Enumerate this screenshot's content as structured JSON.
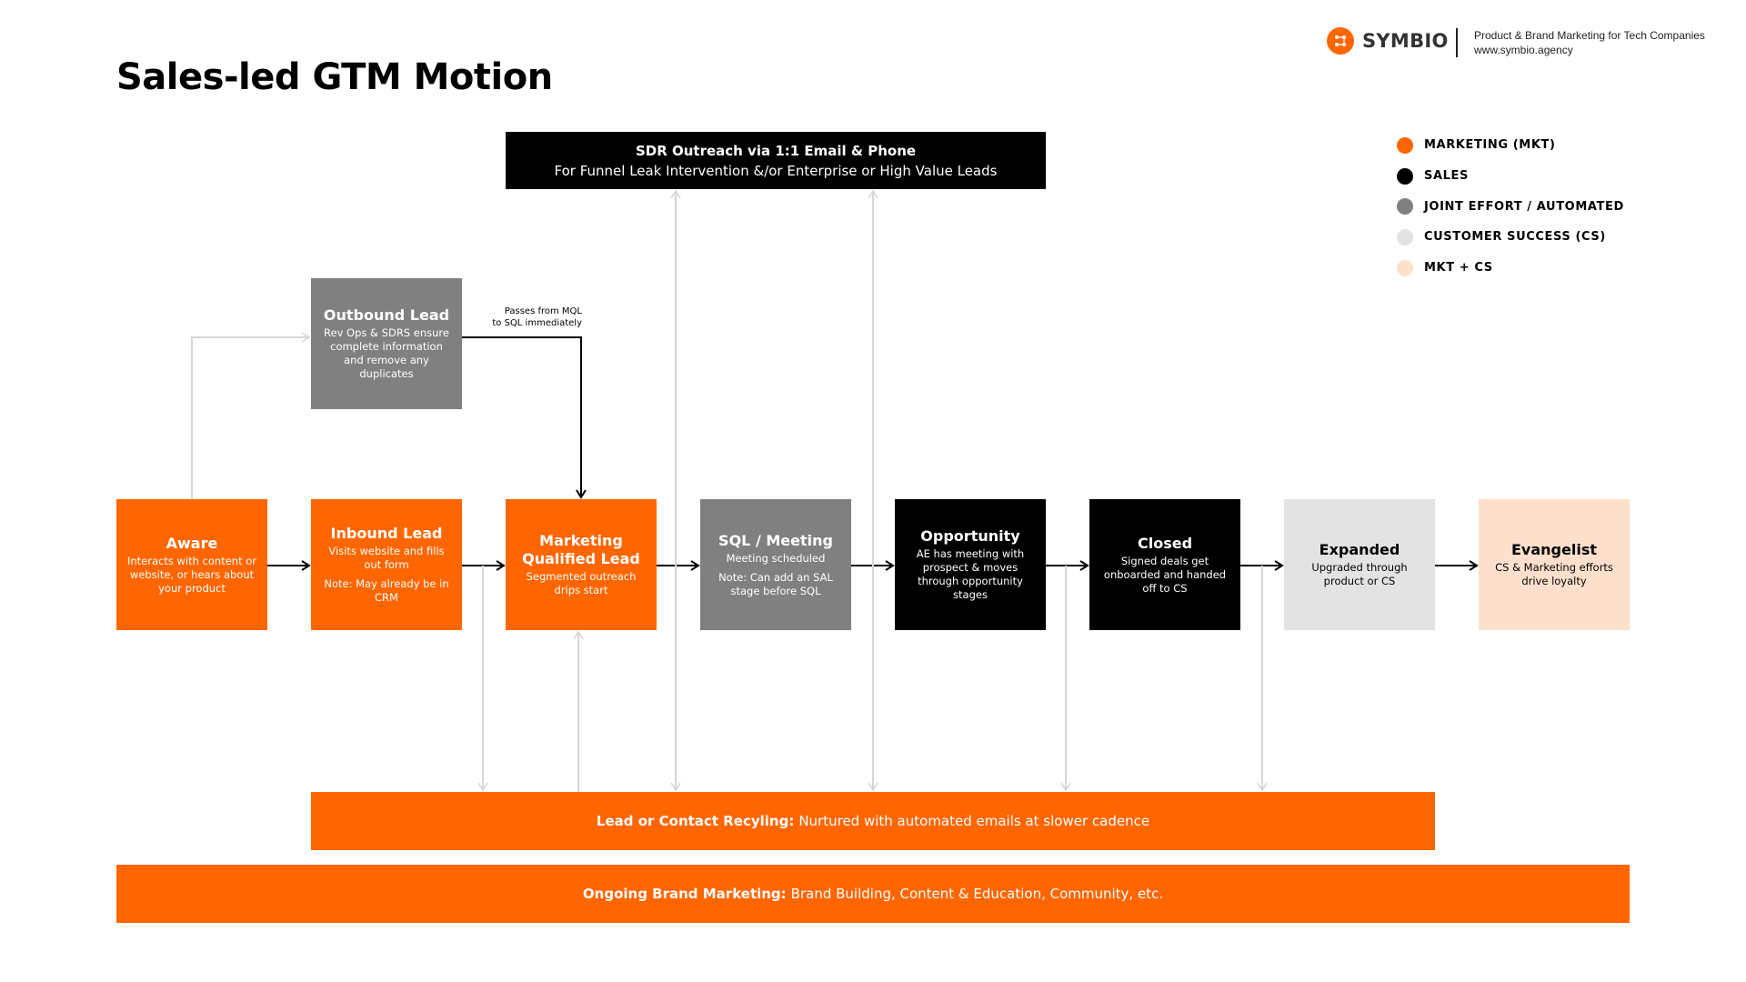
{
  "title": "Sales-led GTM Motion",
  "brand": {
    "logo_icon": "symbio-nodes-icon",
    "name": "SYMBIO",
    "tagline": "Product & Brand Marketing for Tech Companies",
    "website": "www.symbio.agency"
  },
  "colors": {
    "marketing": "#ff6600",
    "sales": "#000000",
    "joint": "#808080",
    "cs": "#e3e3e3",
    "mkt_cs": "#fde0cc",
    "connector_light": "#d6d6d6"
  },
  "legend": [
    {
      "label": "MARKETING (MKT)",
      "color": "#ff6600"
    },
    {
      "label": "SALES",
      "color": "#000000"
    },
    {
      "label": "JOINT EFFORT / AUTOMATED",
      "color": "#808080"
    },
    {
      "label": "CUSTOMER SUCCESS (CS)",
      "color": "#e3e3e3"
    },
    {
      "label": "MKT + CS",
      "color": "#fde0cc"
    }
  ],
  "sdr": {
    "title": "SDR Outreach via 1:1 Email & Phone",
    "subtitle": "For Funnel Leak Intervention &/or Enterprise or High Value Leads"
  },
  "outbound": {
    "title": "Outbound Lead",
    "desc": "Rev Ops & SDRS ensure complete information and remove any duplicates"
  },
  "outbound_note": {
    "line1": "Passes from MQL",
    "line2": "to SQL immediately"
  },
  "stages": [
    {
      "title": "Aware",
      "desc": "Interacts with content or website, or hears about your product",
      "note": ""
    },
    {
      "title": "Inbound Lead",
      "desc": "Visits website and fills out form",
      "note": "Note: May already be in CRM"
    },
    {
      "title": "Marketing Qualified Lead",
      "desc": "Segmented outreach drips start",
      "note": ""
    },
    {
      "title": "SQL /  Meeting",
      "desc": "Meeting scheduled",
      "note": "Note: Can add an SAL stage before SQL"
    },
    {
      "title": "Opportunity",
      "desc": "AE has meeting with prospect & moves through opportunity stages",
      "note": ""
    },
    {
      "title": "Closed",
      "desc": "Signed deals get onboarded and handed off to CS",
      "note": ""
    },
    {
      "title": "Expanded",
      "desc": "Upgraded through product or CS",
      "note": ""
    },
    {
      "title": "Evangelist",
      "desc": "CS & Marketing efforts drive loyalty",
      "note": ""
    }
  ],
  "recycling": {
    "label": "Lead or Contact Recyling:",
    "text": "Nurtured with automated emails at slower cadence"
  },
  "brand_marketing": {
    "label": "Ongoing Brand Marketing:",
    "text": "Brand Building, Content & Education, Community, etc."
  }
}
